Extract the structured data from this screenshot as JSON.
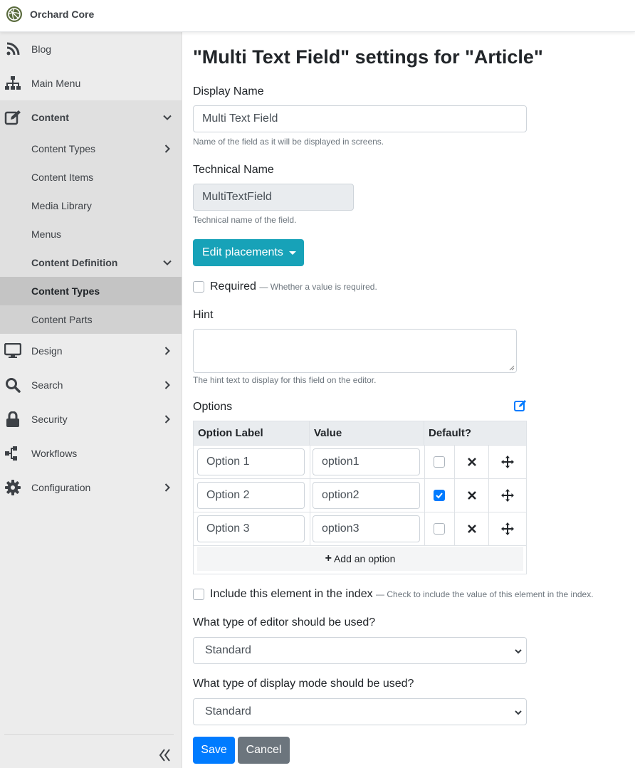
{
  "brand": {
    "name": "Orchard Core",
    "logo_icon": "orchard-logo-icon"
  },
  "sidebar": {
    "items": [
      {
        "label": "Blog",
        "icon": "rss-icon"
      },
      {
        "label": "Main Menu",
        "icon": "sitemap-icon"
      },
      {
        "label": "Content",
        "icon": "edit-icon",
        "expanded": true
      },
      {
        "label": "Content Types"
      },
      {
        "label": "Content Items"
      },
      {
        "label": "Media Library"
      },
      {
        "label": "Menus"
      },
      {
        "label": "Content Definition",
        "expanded": true
      },
      {
        "label": "Content Types",
        "active": true
      },
      {
        "label": "Content Parts"
      },
      {
        "label": "Design",
        "icon": "desktop-icon"
      },
      {
        "label": "Search",
        "icon": "search-icon"
      },
      {
        "label": "Security",
        "icon": "lock-icon"
      },
      {
        "label": "Workflows",
        "icon": "workflow-icon"
      },
      {
        "label": "Configuration",
        "icon": "cog-icon"
      }
    ]
  },
  "page": {
    "title": "\"Multi Text Field\" settings for \"Article\"",
    "display_name": {
      "label": "Display Name",
      "value": "Multi Text Field",
      "help": "Name of the field as it will be displayed in screens."
    },
    "technical_name": {
      "label": "Technical Name",
      "value": "MultiTextField",
      "help": "Technical name of the field."
    },
    "edit_placements_label": "Edit placements",
    "required": {
      "label": "Required",
      "hint": "— Whether a value is required.",
      "checked": false
    },
    "hint": {
      "label": "Hint",
      "value": "",
      "help": "The hint text to display for this field on the editor."
    },
    "options": {
      "label": "Options",
      "columns": [
        "Option Label",
        "Value",
        "Default?"
      ],
      "rows": [
        {
          "label": "Option 1",
          "value": "option1",
          "default": false
        },
        {
          "label": "Option 2",
          "value": "option2",
          "default": true
        },
        {
          "label": "Option 3",
          "value": "option3",
          "default": false
        }
      ],
      "add_label": "Add an option"
    },
    "index": {
      "label": "Include this element in the index",
      "hint": "— Check to include the value of this element in the index.",
      "checked": false
    },
    "editor": {
      "label": "What type of editor should be used?",
      "value": "Standard"
    },
    "display_mode": {
      "label": "What type of display mode should be used?",
      "value": "Standard"
    },
    "save_label": "Save",
    "cancel_label": "Cancel"
  },
  "colors": {
    "accent_info": "#17a2b8",
    "primary": "#007bff",
    "secondary": "#6c757d"
  }
}
